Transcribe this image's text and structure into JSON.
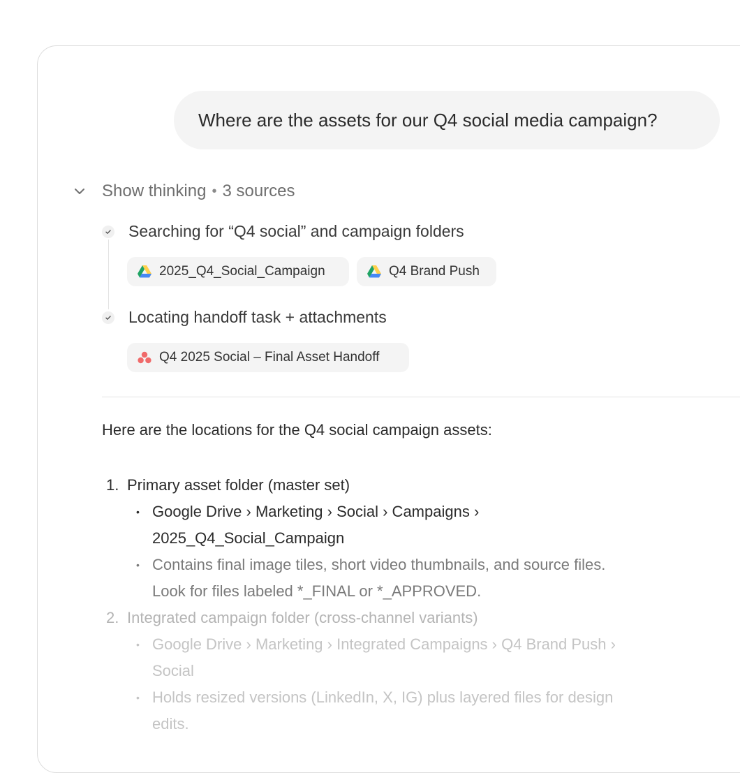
{
  "user_message": "Where are the assets for our Q4 social media campaign?",
  "thinking": {
    "label": "Show thinking",
    "separator": "•",
    "sources": "3 sources",
    "steps": [
      {
        "text": "Searching for “Q4 social” and campaign folders",
        "chips": [
          {
            "label": "2025_Q4_Social_Campaign",
            "icon": "google-drive-icon"
          },
          {
            "label": "Q4 Brand Push",
            "icon": "google-drive-icon"
          }
        ]
      },
      {
        "text": "Locating handoff task + attachments",
        "chips": [
          {
            "label": "Q4 2025 Social – Final Asset Handoff",
            "icon": "asana-icon"
          }
        ]
      }
    ]
  },
  "answer": {
    "intro": "Here are the locations for the Q4 social campaign assets:",
    "items": [
      {
        "number": "1.",
        "title": "Primary asset folder (master set)",
        "bullets": [
          {
            "line1": "Google Drive › Marketing › Social › Campaigns ›",
            "line2": "2025_Q4_Social_Campaign"
          },
          {
            "line1": "Contains final image tiles, short video thumbnails, and source files.",
            "line2": "Look for files labeled *_FINAL or *_APPROVED."
          }
        ]
      },
      {
        "number": "2.",
        "title": "Integrated campaign folder (cross-channel variants)",
        "bullets": [
          {
            "line1": "Google Drive › Marketing › Integrated Campaigns › Q4 Brand Push ›",
            "line2": "Social"
          },
          {
            "line1": "Holds resized versions (LinkedIn, X, IG) plus layered files for design",
            "line2": "edits."
          }
        ]
      }
    ]
  },
  "colors": {
    "bubble_bg": "#f4f4f4",
    "chip_bg": "#f4f4f4",
    "asana": "#f06a6a",
    "drive_green": "#1fa463",
    "drive_yellow": "#ffd04b",
    "drive_blue": "#4688f4"
  }
}
